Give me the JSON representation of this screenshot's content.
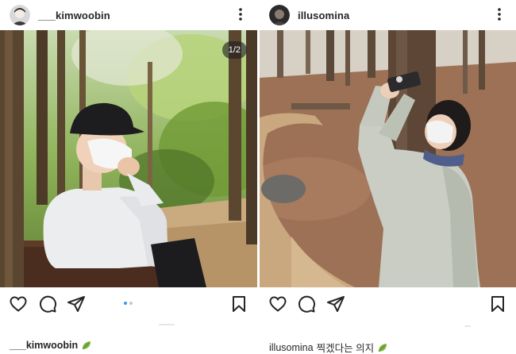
{
  "left_post": {
    "username": "___kimwoobin",
    "media_counter": "1/2",
    "icons": [
      "heart-icon",
      "comment-icon",
      "share-icon",
      "bookmark-icon",
      "more-icon"
    ],
    "carousel": {
      "count": 2,
      "active": 1,
      "active_color": "#3897f0",
      "inactive_color": "#c7c7c7"
    },
    "caption_username": "___kimwoobin",
    "caption_emoji": "leaf-icon"
  },
  "right_post": {
    "username": "illusomina",
    "icons": [
      "heart-icon",
      "comment-icon",
      "share-icon",
      "bookmark-icon",
      "more-icon"
    ],
    "caption_username": "illusomina",
    "caption_text": "찍겠다는 의지",
    "caption_emoji": "leaf-icon"
  },
  "colors": {
    "text": "#262626",
    "background": "#ffffff",
    "accent": "#3897f0"
  }
}
